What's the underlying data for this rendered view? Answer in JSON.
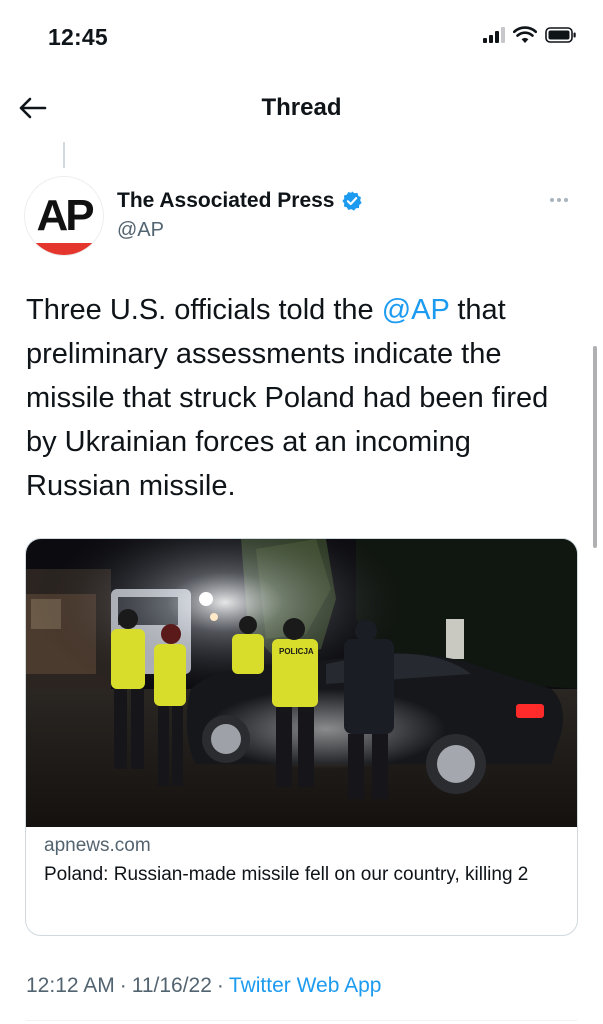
{
  "status_bar": {
    "time": "12:45"
  },
  "nav": {
    "title": "Thread"
  },
  "tweet": {
    "author": {
      "avatar_text": "AP",
      "name": "The Associated Press",
      "handle": "@AP",
      "verified": true
    },
    "text_before": "Three U.S. officials told the ",
    "mention": "@AP",
    "text_after": " that preliminary assessments indicate the missile that struck Poland had been fired by Ukrainian forces at an incoming Russian missile.",
    "card": {
      "image_sign_text": "POLICJA",
      "domain": "apnews.com",
      "title": "Poland: Russian-made missile fell on our country, killing 2"
    },
    "time": "12:12 AM",
    "date": "11/16/22",
    "separator": "·",
    "source": "Twitter Web App"
  },
  "colors": {
    "accent": "#1d9bf0",
    "verified": "#1d9bf0",
    "secondary_text": "#536471",
    "ap_red": "#e4362d"
  },
  "icons": {
    "back": "arrow-left-icon",
    "more": "more-horizontal-icon",
    "verified": "verified-badge-icon",
    "signal": "cellular-signal-icon",
    "wifi": "wifi-icon",
    "battery": "battery-icon"
  }
}
